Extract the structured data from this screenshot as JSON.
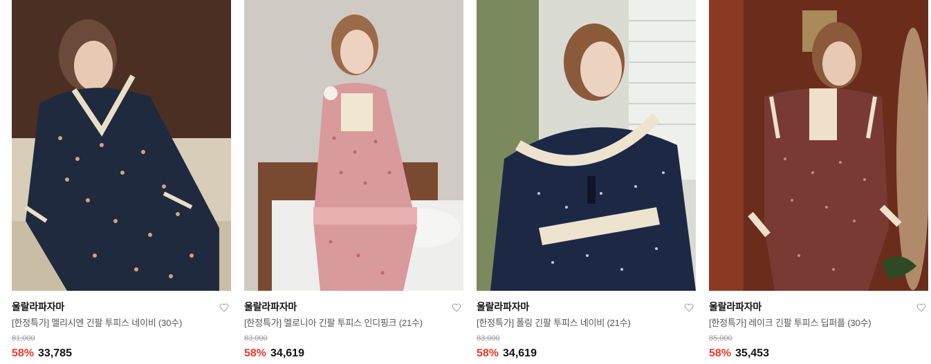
{
  "products": [
    {
      "brand": "울랄라파자마",
      "name": "[한정특가] 멜리시엔 긴팔 투피스 네이비 (30수)",
      "original_price": "81,000",
      "discount": "58%",
      "price": "33,785",
      "image": {
        "background": "#5a3a2a",
        "garment": "#1f2a3f",
        "pattern": "#d9a07a",
        "lace": "#e9dfc8"
      }
    },
    {
      "brand": "울랄라파자마",
      "name": "[한정특가] 멜로니아 긴팔 투피스 인디핑크 (21수)",
      "original_price": "83,000",
      "discount": "58%",
      "price": "34,619",
      "image": {
        "background": "#cfcbc5",
        "garment": "#d99a9c",
        "pattern": "#b9686e",
        "lace": "#f1e6d2"
      }
    },
    {
      "brand": "울랄라파자마",
      "name": "[한정특가] 폴링 긴팔 투피스 네이비 (21수)",
      "original_price": "83,000",
      "discount": "58%",
      "price": "34,619",
      "image": {
        "background": "#d9dcd6",
        "garment": "#1d2944",
        "pattern": "#c8c4d8",
        "lace": "#ede3cf"
      }
    },
    {
      "brand": "울랄라파자마",
      "name": "[한정특가] 레이크 긴팔 투피스 딥퍼플 (30수)",
      "original_price": "85,000",
      "discount": "58%",
      "price": "35,453",
      "image": {
        "background": "#6e2e1e",
        "garment": "#7a3a34",
        "pattern": "#c58a80",
        "lace": "#efe1c9"
      }
    }
  ]
}
